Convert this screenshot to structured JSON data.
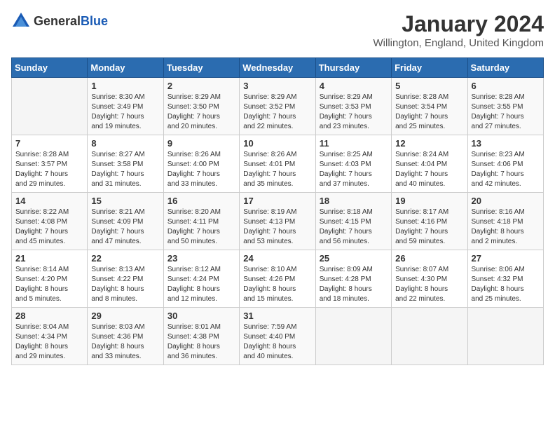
{
  "logo": {
    "text_general": "General",
    "text_blue": "Blue"
  },
  "title": {
    "month_year": "January 2024",
    "location": "Willington, England, United Kingdom"
  },
  "days_of_week": [
    "Sunday",
    "Monday",
    "Tuesday",
    "Wednesday",
    "Thursday",
    "Friday",
    "Saturday"
  ],
  "weeks": [
    [
      {
        "day": "",
        "info": ""
      },
      {
        "day": "1",
        "info": "Sunrise: 8:30 AM\nSunset: 3:49 PM\nDaylight: 7 hours\nand 19 minutes."
      },
      {
        "day": "2",
        "info": "Sunrise: 8:29 AM\nSunset: 3:50 PM\nDaylight: 7 hours\nand 20 minutes."
      },
      {
        "day": "3",
        "info": "Sunrise: 8:29 AM\nSunset: 3:52 PM\nDaylight: 7 hours\nand 22 minutes."
      },
      {
        "day": "4",
        "info": "Sunrise: 8:29 AM\nSunset: 3:53 PM\nDaylight: 7 hours\nand 23 minutes."
      },
      {
        "day": "5",
        "info": "Sunrise: 8:28 AM\nSunset: 3:54 PM\nDaylight: 7 hours\nand 25 minutes."
      },
      {
        "day": "6",
        "info": "Sunrise: 8:28 AM\nSunset: 3:55 PM\nDaylight: 7 hours\nand 27 minutes."
      }
    ],
    [
      {
        "day": "7",
        "info": "Sunrise: 8:28 AM\nSunset: 3:57 PM\nDaylight: 7 hours\nand 29 minutes."
      },
      {
        "day": "8",
        "info": "Sunrise: 8:27 AM\nSunset: 3:58 PM\nDaylight: 7 hours\nand 31 minutes."
      },
      {
        "day": "9",
        "info": "Sunrise: 8:26 AM\nSunset: 4:00 PM\nDaylight: 7 hours\nand 33 minutes."
      },
      {
        "day": "10",
        "info": "Sunrise: 8:26 AM\nSunset: 4:01 PM\nDaylight: 7 hours\nand 35 minutes."
      },
      {
        "day": "11",
        "info": "Sunrise: 8:25 AM\nSunset: 4:03 PM\nDaylight: 7 hours\nand 37 minutes."
      },
      {
        "day": "12",
        "info": "Sunrise: 8:24 AM\nSunset: 4:04 PM\nDaylight: 7 hours\nand 40 minutes."
      },
      {
        "day": "13",
        "info": "Sunrise: 8:23 AM\nSunset: 4:06 PM\nDaylight: 7 hours\nand 42 minutes."
      }
    ],
    [
      {
        "day": "14",
        "info": "Sunrise: 8:22 AM\nSunset: 4:08 PM\nDaylight: 7 hours\nand 45 minutes."
      },
      {
        "day": "15",
        "info": "Sunrise: 8:21 AM\nSunset: 4:09 PM\nDaylight: 7 hours\nand 47 minutes."
      },
      {
        "day": "16",
        "info": "Sunrise: 8:20 AM\nSunset: 4:11 PM\nDaylight: 7 hours\nand 50 minutes."
      },
      {
        "day": "17",
        "info": "Sunrise: 8:19 AM\nSunset: 4:13 PM\nDaylight: 7 hours\nand 53 minutes."
      },
      {
        "day": "18",
        "info": "Sunrise: 8:18 AM\nSunset: 4:15 PM\nDaylight: 7 hours\nand 56 minutes."
      },
      {
        "day": "19",
        "info": "Sunrise: 8:17 AM\nSunset: 4:16 PM\nDaylight: 7 hours\nand 59 minutes."
      },
      {
        "day": "20",
        "info": "Sunrise: 8:16 AM\nSunset: 4:18 PM\nDaylight: 8 hours\nand 2 minutes."
      }
    ],
    [
      {
        "day": "21",
        "info": "Sunrise: 8:14 AM\nSunset: 4:20 PM\nDaylight: 8 hours\nand 5 minutes."
      },
      {
        "day": "22",
        "info": "Sunrise: 8:13 AM\nSunset: 4:22 PM\nDaylight: 8 hours\nand 8 minutes."
      },
      {
        "day": "23",
        "info": "Sunrise: 8:12 AM\nSunset: 4:24 PM\nDaylight: 8 hours\nand 12 minutes."
      },
      {
        "day": "24",
        "info": "Sunrise: 8:10 AM\nSunset: 4:26 PM\nDaylight: 8 hours\nand 15 minutes."
      },
      {
        "day": "25",
        "info": "Sunrise: 8:09 AM\nSunset: 4:28 PM\nDaylight: 8 hours\nand 18 minutes."
      },
      {
        "day": "26",
        "info": "Sunrise: 8:07 AM\nSunset: 4:30 PM\nDaylight: 8 hours\nand 22 minutes."
      },
      {
        "day": "27",
        "info": "Sunrise: 8:06 AM\nSunset: 4:32 PM\nDaylight: 8 hours\nand 25 minutes."
      }
    ],
    [
      {
        "day": "28",
        "info": "Sunrise: 8:04 AM\nSunset: 4:34 PM\nDaylight: 8 hours\nand 29 minutes."
      },
      {
        "day": "29",
        "info": "Sunrise: 8:03 AM\nSunset: 4:36 PM\nDaylight: 8 hours\nand 33 minutes."
      },
      {
        "day": "30",
        "info": "Sunrise: 8:01 AM\nSunset: 4:38 PM\nDaylight: 8 hours\nand 36 minutes."
      },
      {
        "day": "31",
        "info": "Sunrise: 7:59 AM\nSunset: 4:40 PM\nDaylight: 8 hours\nand 40 minutes."
      },
      {
        "day": "",
        "info": ""
      },
      {
        "day": "",
        "info": ""
      },
      {
        "day": "",
        "info": ""
      }
    ]
  ]
}
